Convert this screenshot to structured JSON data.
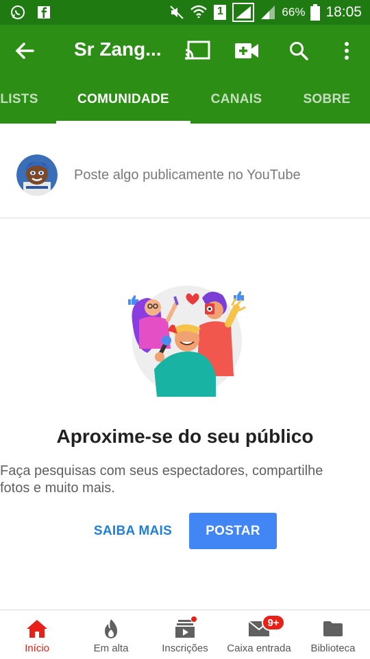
{
  "status_bar": {
    "battery_percent": "66%",
    "time": "18:05",
    "sim_slot": "1",
    "icons": [
      "whatsapp-icon",
      "facebook-icon",
      "mute-icon",
      "wifi-icon",
      "sim-icon",
      "signal-icon",
      "signal-icon",
      "battery-icon"
    ]
  },
  "app_bar": {
    "title": "Sr Zang...",
    "icons": [
      "back-arrow-icon",
      "cast-icon",
      "video-add-icon",
      "search-icon",
      "more-vert-icon"
    ]
  },
  "tabs": [
    {
      "label": "LISTS",
      "active": false
    },
    {
      "label": "COMUNIDADE",
      "active": true
    },
    {
      "label": "CANAIS",
      "active": false
    },
    {
      "label": "SOBRE",
      "active": false
    }
  ],
  "post_box": {
    "placeholder": "Poste algo publicamente no YouTube"
  },
  "empty_state": {
    "headline": "Aproxime-se do seu público",
    "description": "Faça pesquisas com seus espectadores, compartilhe fotos e muito mais.",
    "learn_more_label": "SAIBA MAIS",
    "post_label": "POSTAR"
  },
  "bottom_nav": [
    {
      "label": "Início",
      "icon": "home-icon",
      "active": true
    },
    {
      "label": "Em alta",
      "icon": "trending-flame-icon",
      "active": false
    },
    {
      "label": "Inscrições",
      "icon": "subscriptions-icon",
      "active": false
    },
    {
      "label": "Caixa entrada",
      "icon": "mail-icon",
      "active": false,
      "badge": "9+"
    },
    {
      "label": "Biblioteca",
      "icon": "folder-icon",
      "active": false
    }
  ],
  "colors": {
    "status_bar": "#1f7a12",
    "app_bar": "#2d8e16",
    "primary_button": "#4285f4",
    "link_blue": "#1f7fd6",
    "active_red": "#e62117"
  }
}
